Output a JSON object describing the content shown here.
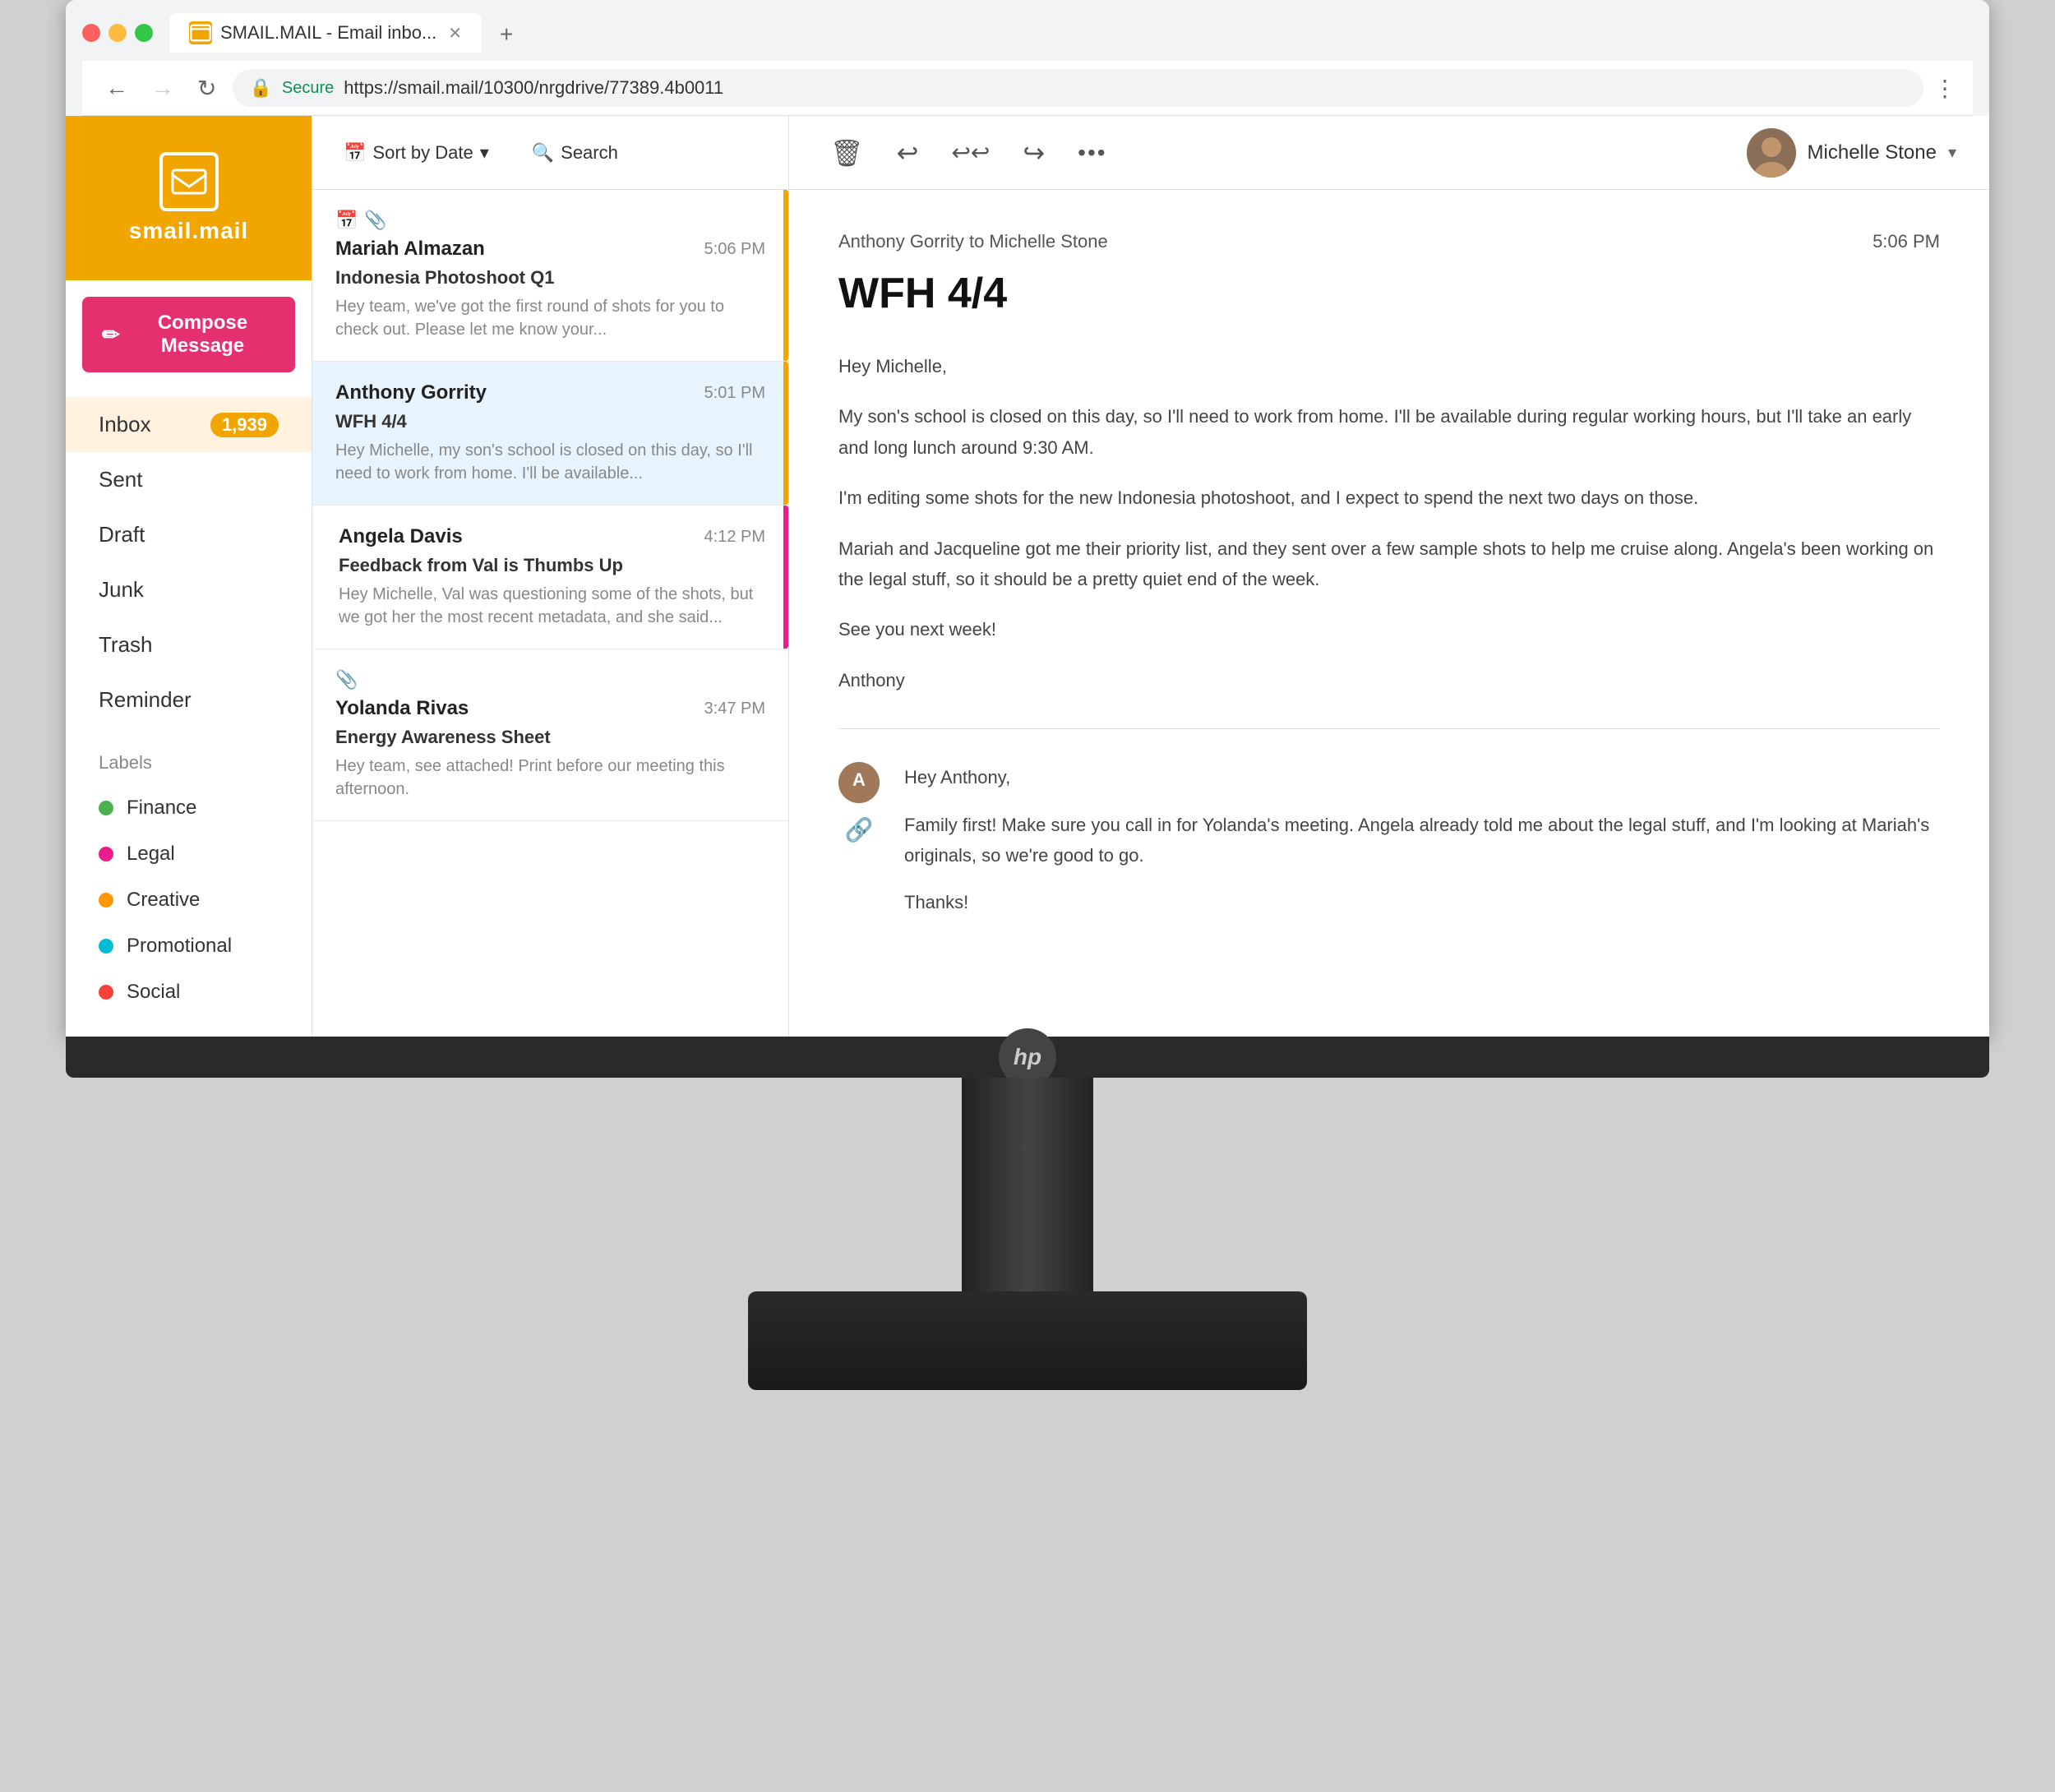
{
  "browser": {
    "tab_label": "SMAIL.MAIL - Email inbo...",
    "url": "https://smail.mail/10300/nrgdrive/77389.4b0011",
    "secure_text": "Secure"
  },
  "sidebar": {
    "logo_text": "smail.mail",
    "compose_label": "Compose Message",
    "nav_items": [
      {
        "label": "Inbox",
        "badge": "1,939"
      },
      {
        "label": "Sent",
        "badge": ""
      },
      {
        "label": "Draft",
        "badge": ""
      },
      {
        "label": "Junk",
        "badge": ""
      },
      {
        "label": "Trash",
        "badge": ""
      },
      {
        "label": "Reminder",
        "badge": ""
      }
    ],
    "labels_title": "Labels",
    "labels": [
      {
        "label": "Finance",
        "color": "#4caf50"
      },
      {
        "label": "Legal",
        "color": "#e91e8c"
      },
      {
        "label": "Creative",
        "color": "#ff9800"
      },
      {
        "label": "Promotional",
        "color": "#00bcd4"
      },
      {
        "label": "Social",
        "color": "#f44336"
      }
    ]
  },
  "email_list": {
    "sort_label": "Sort by Date",
    "search_label": "Search",
    "emails": [
      {
        "sender": "Mariah Almazan",
        "subject": "Indonesia Photoshoot Q1",
        "preview": "Hey team, we've got the first round of shots for you to check out. Please let me know your...",
        "time": "5:06 PM",
        "has_calendar": true,
        "has_attachment": true,
        "priority": "orange"
      },
      {
        "sender": "Anthony Gorrity",
        "subject": "WFH 4/4",
        "preview": "Hey Michelle, my son's school is closed on this day, so I'll need to work from home. I'll be available...",
        "time": "5:01 PM",
        "has_calendar": false,
        "has_attachment": false,
        "priority": "orange",
        "selected": true
      },
      {
        "sender": "Angela Davis",
        "subject": "Feedback from Val is Thumbs Up",
        "preview": "Hey Michelle, Val was questioning some of the shots, but we got her the most recent metadata, and she said...",
        "time": "4:12 PM",
        "has_calendar": false,
        "has_attachment": false,
        "priority": "pink"
      },
      {
        "sender": "Yolanda Rivas",
        "subject": "Energy Awareness Sheet",
        "preview": "Hey team, see attached! Print before our meeting this afternoon.",
        "time": "3:47 PM",
        "has_calendar": false,
        "has_attachment": true,
        "priority": ""
      }
    ]
  },
  "toolbar": {
    "delete_icon": "🗑",
    "reply_icon": "↩",
    "reply_all_icon": "↩↩",
    "forward_icon": "↪",
    "more_icon": "•••",
    "user_name": "Michelle Stone"
  },
  "email_view": {
    "from_to": "Anthony Gorrity to Michelle Stone",
    "time": "5:06 PM",
    "subject": "WFH 4/4",
    "body_paragraphs": [
      "Hey Michelle,",
      "My son's school is closed on this day, so I'll need to work from home. I'll be available during regular working hours, but I'll take an early and long lunch around 9:30 AM.",
      "I'm editing some shots for the new Indonesia photoshoot, and I expect to spend the next two days on those.",
      "Mariah and Jacqueline got me their priority list, and they sent over a few sample shots to help me cruise along. Angela's been working on the legal stuff, so it should be a pretty quiet end of the week.",
      "See you next week!",
      "Anthony"
    ],
    "reply_paragraphs": [
      "Hey Anthony,",
      "Family first! Make sure you call in for Yolanda's meeting. Angela already told me about the legal stuff, and I'm looking at Mariah's originals, so we're good to go.",
      "Thanks!"
    ]
  }
}
